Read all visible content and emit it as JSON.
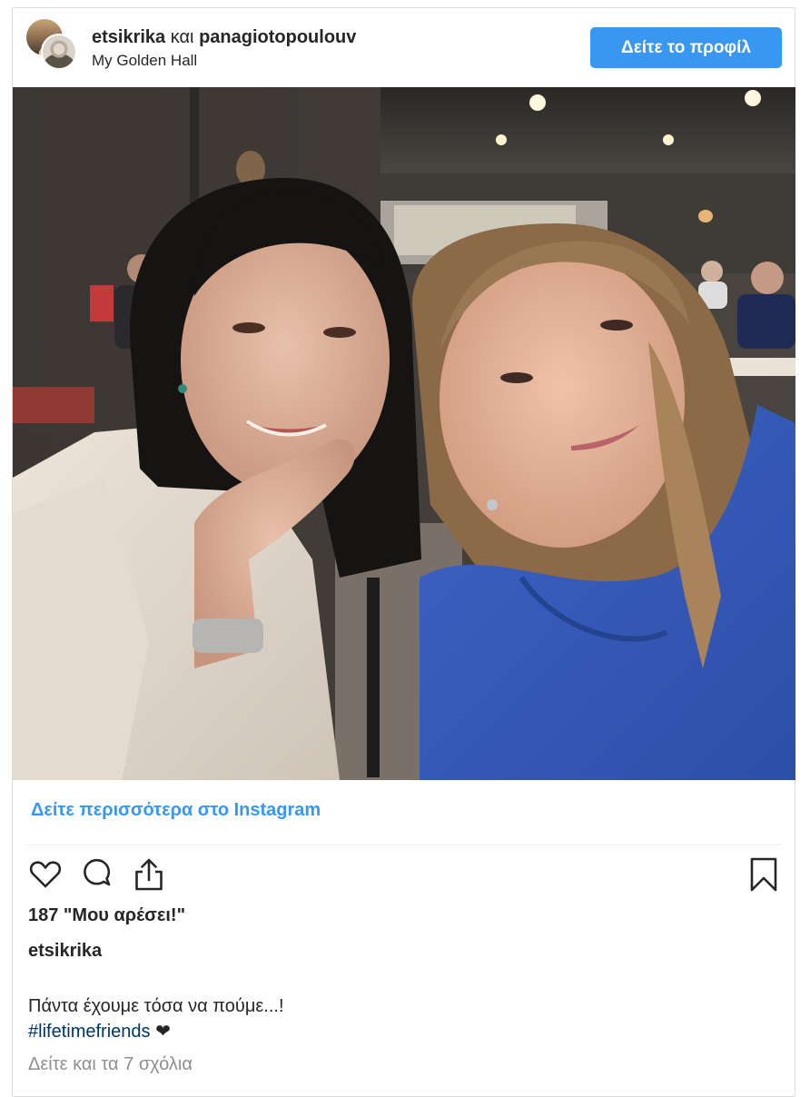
{
  "post": {
    "user1": "etsikrika",
    "and_word": "και",
    "user2": "panagiotopoulouv",
    "location": "My Golden Hall",
    "view_profile_label": "Δείτε το προφίλ",
    "more_on_instagram": "Δείτε περισσότερα στο Instagram",
    "likes_text": "187 \"Μου αρέσει!\"",
    "author": "etsikrika",
    "caption_line1": "Πάντα έχουμε τόσα να πούμε...!",
    "hashtag": "#lifetimefriends",
    "heart_glyph": "❤",
    "view_comments": "Δείτε και τα 7 σχόλια"
  },
  "icons": {
    "like": "heart-icon",
    "comment": "comment-icon",
    "share": "share-icon",
    "save": "bookmark-icon"
  },
  "colors": {
    "accent": "#3897f0",
    "hashtag": "#003569",
    "muted": "#8e8e8e"
  }
}
